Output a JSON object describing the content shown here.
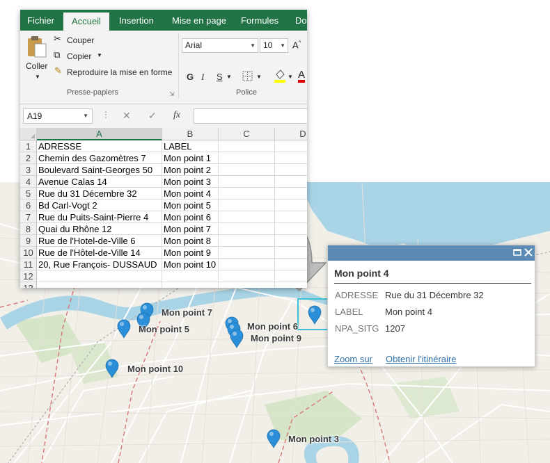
{
  "excel": {
    "tabs": [
      "Fichier",
      "Accueil",
      "Insertion",
      "Mise en page",
      "Formules",
      "Do"
    ],
    "active_tab": "Accueil",
    "clipboard": {
      "paste": "Coller",
      "cut": "Couper",
      "copy": "Copier",
      "format_painter": "Reproduire la mise en forme",
      "group": "Presse-papiers"
    },
    "font": {
      "name": "Arial",
      "size": "10",
      "bold": "G",
      "italic": "I",
      "underline": "S",
      "group": "Police"
    },
    "name_box": "A19",
    "fx": "fx",
    "columns": [
      "A",
      "B",
      "C",
      "D"
    ],
    "selected_column": "A",
    "rows": [
      {
        "n": "1",
        "a": "ADRESSE",
        "b": "LABEL"
      },
      {
        "n": "2",
        "a": "Chemin des Gazomètres 7",
        "b": "Mon point 1"
      },
      {
        "n": "3",
        "a": "Boulevard Saint-Georges 50",
        "b": "Mon point 2"
      },
      {
        "n": "4",
        "a": "Avenue Calas 14",
        "b": "Mon point 3"
      },
      {
        "n": "5",
        "a": "Rue du 31 Décembre 32",
        "b": "Mon point 4"
      },
      {
        "n": "6",
        "a": "Bd Carl-Vogt 2",
        "b": "Mon point 5"
      },
      {
        "n": "7",
        "a": "Rue du Puits-Saint-Pierre 4",
        "b": "Mon point 6"
      },
      {
        "n": "8",
        "a": "Quai du Rhône 12",
        "b": "Mon point 7"
      },
      {
        "n": "9",
        "a": "Rue de l'Hotel-de-Ville 6",
        "b": "Mon point 8"
      },
      {
        "n": "10",
        "a": "Rue de l'Hôtel-de-Ville 14",
        "b": "Mon point 9"
      },
      {
        "n": "11",
        "a": "20, Rue François- DUSSAUD",
        "b": "Mon point 10"
      },
      {
        "n": "12",
        "a": "",
        "b": ""
      },
      {
        "n": "13",
        "a": "",
        "b": ""
      }
    ],
    "accent_color": "#217346"
  },
  "map": {
    "pins": [
      "Mon point 7",
      "Mon point 5",
      "Mon point 6",
      "Mon point 9",
      "Mon point 10",
      "Mon point 3"
    ],
    "pin_color": "#2a8fd8",
    "water_color": "#a8d4e6"
  },
  "popup": {
    "title": "Mon point 4",
    "fields": [
      {
        "name": "ADRESSE",
        "value": "Rue du 31 Décembre 32"
      },
      {
        "name": "LABEL",
        "value": "Mon point 4"
      },
      {
        "name": "NPA_SITG",
        "value": "1207"
      }
    ],
    "zoom_link": "Zoom sur",
    "route_link": "Obtenir l'itinéraire",
    "header_color": "#5b8bb4"
  }
}
